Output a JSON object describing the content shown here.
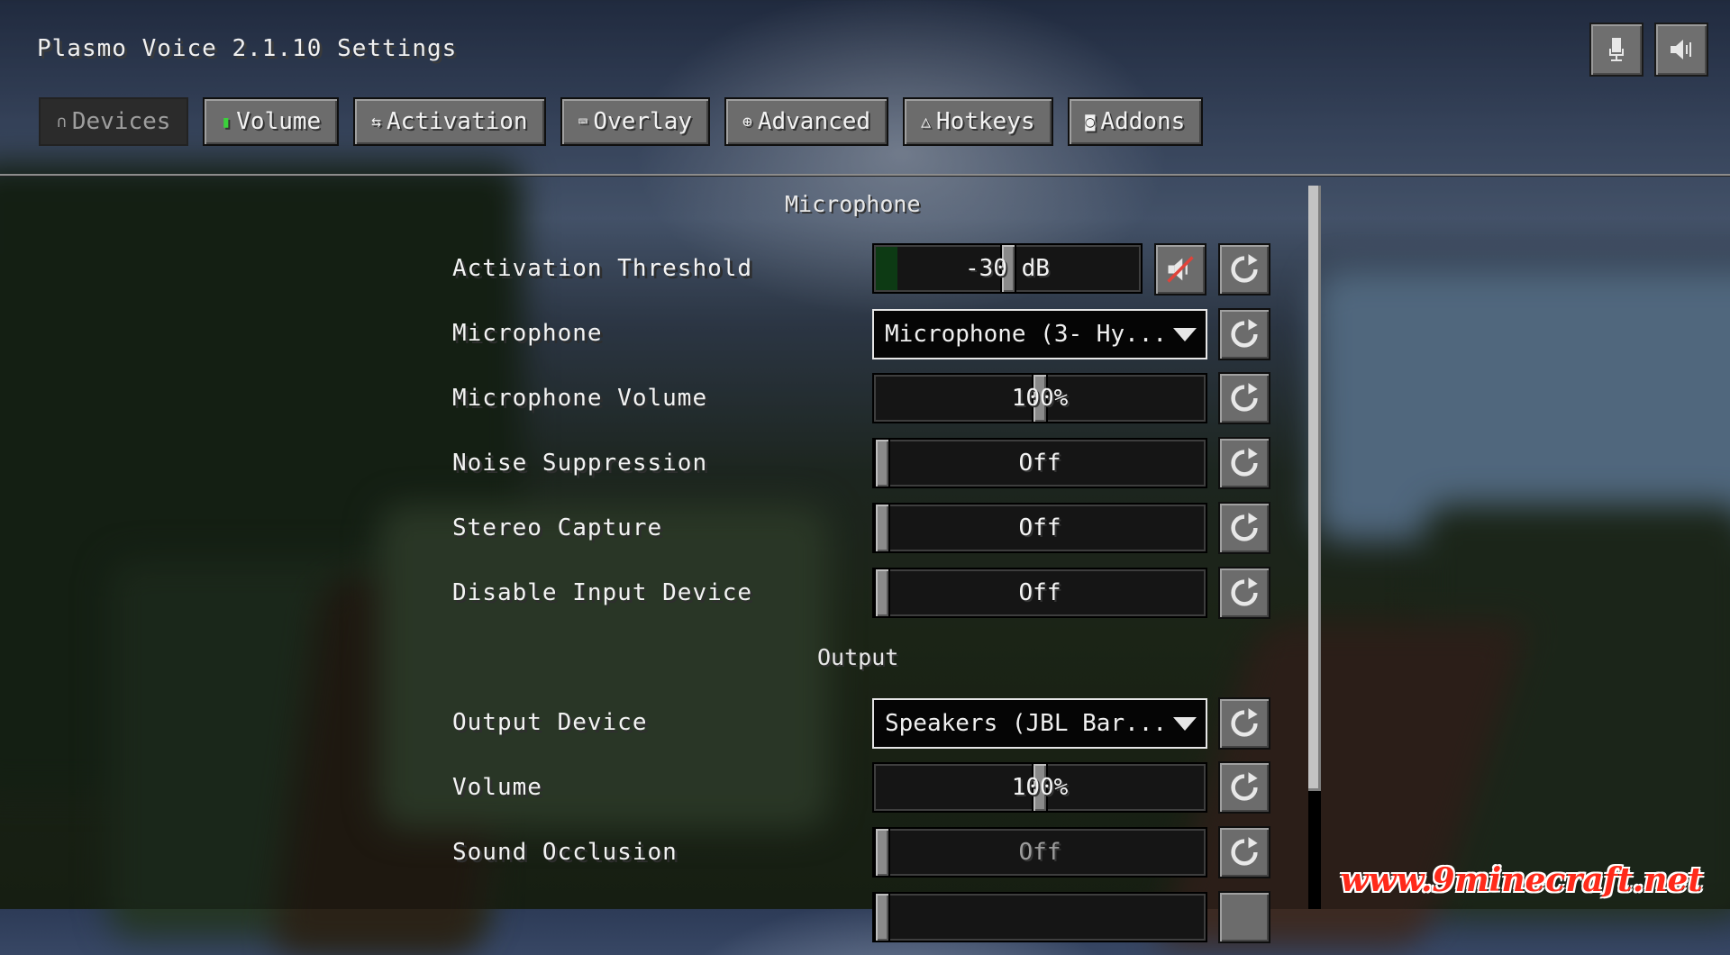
{
  "title": "Plasmo Voice 2.1.10 Settings",
  "top_buttons": [
    {
      "icon": "microphone-icon"
    },
    {
      "icon": "speaker-icon"
    }
  ],
  "tabs": [
    {
      "icon": "headphones-icon",
      "glyph": "∩",
      "label": "Devices",
      "active": true
    },
    {
      "icon": "volume-bars-icon",
      "glyph": "▮",
      "label": "Volume",
      "active": false
    },
    {
      "icon": "activation-icon",
      "glyph": "⇆",
      "label": "Activation",
      "active": false
    },
    {
      "icon": "monitor-icon",
      "glyph": "⌨",
      "label": "Overlay",
      "active": false
    },
    {
      "icon": "advanced-icon",
      "glyph": "⊕",
      "label": "Advanced",
      "active": false
    },
    {
      "icon": "hotkey-icon",
      "glyph": "△",
      "label": "Hotkeys",
      "active": false
    },
    {
      "icon": "addons-icon",
      "glyph": "◙",
      "label": "Addons",
      "active": false
    }
  ],
  "sections": {
    "microphone": "Microphone",
    "output": "Output"
  },
  "rows": {
    "activation_threshold": {
      "label": "Activation Threshold",
      "value": "-30 dB",
      "level": 0.08
    },
    "microphone": {
      "label": "Microphone",
      "value": "Microphone (3- Hy..."
    },
    "microphone_volume": {
      "label": "Microphone Volume",
      "value": "100%",
      "fraction": 0.5
    },
    "noise_suppression": {
      "label": "Noise Suppression",
      "value": "Off"
    },
    "stereo_capture": {
      "label": "Stereo Capture",
      "value": "Off"
    },
    "disable_input_device": {
      "label": "Disable Input Device",
      "value": "Off"
    },
    "output_device": {
      "label": "Output Device",
      "value": "Speakers (JBL Bar..."
    },
    "volume": {
      "label": "Volume",
      "value": "100%",
      "fraction": 0.5
    },
    "sound_occlusion": {
      "label": "Sound Occlusion",
      "value": "Off"
    }
  },
  "watermark": "www.9minecraft.net",
  "colors": {
    "level_green": "#0d3a14",
    "watermark_red": "#ff2a1a"
  }
}
